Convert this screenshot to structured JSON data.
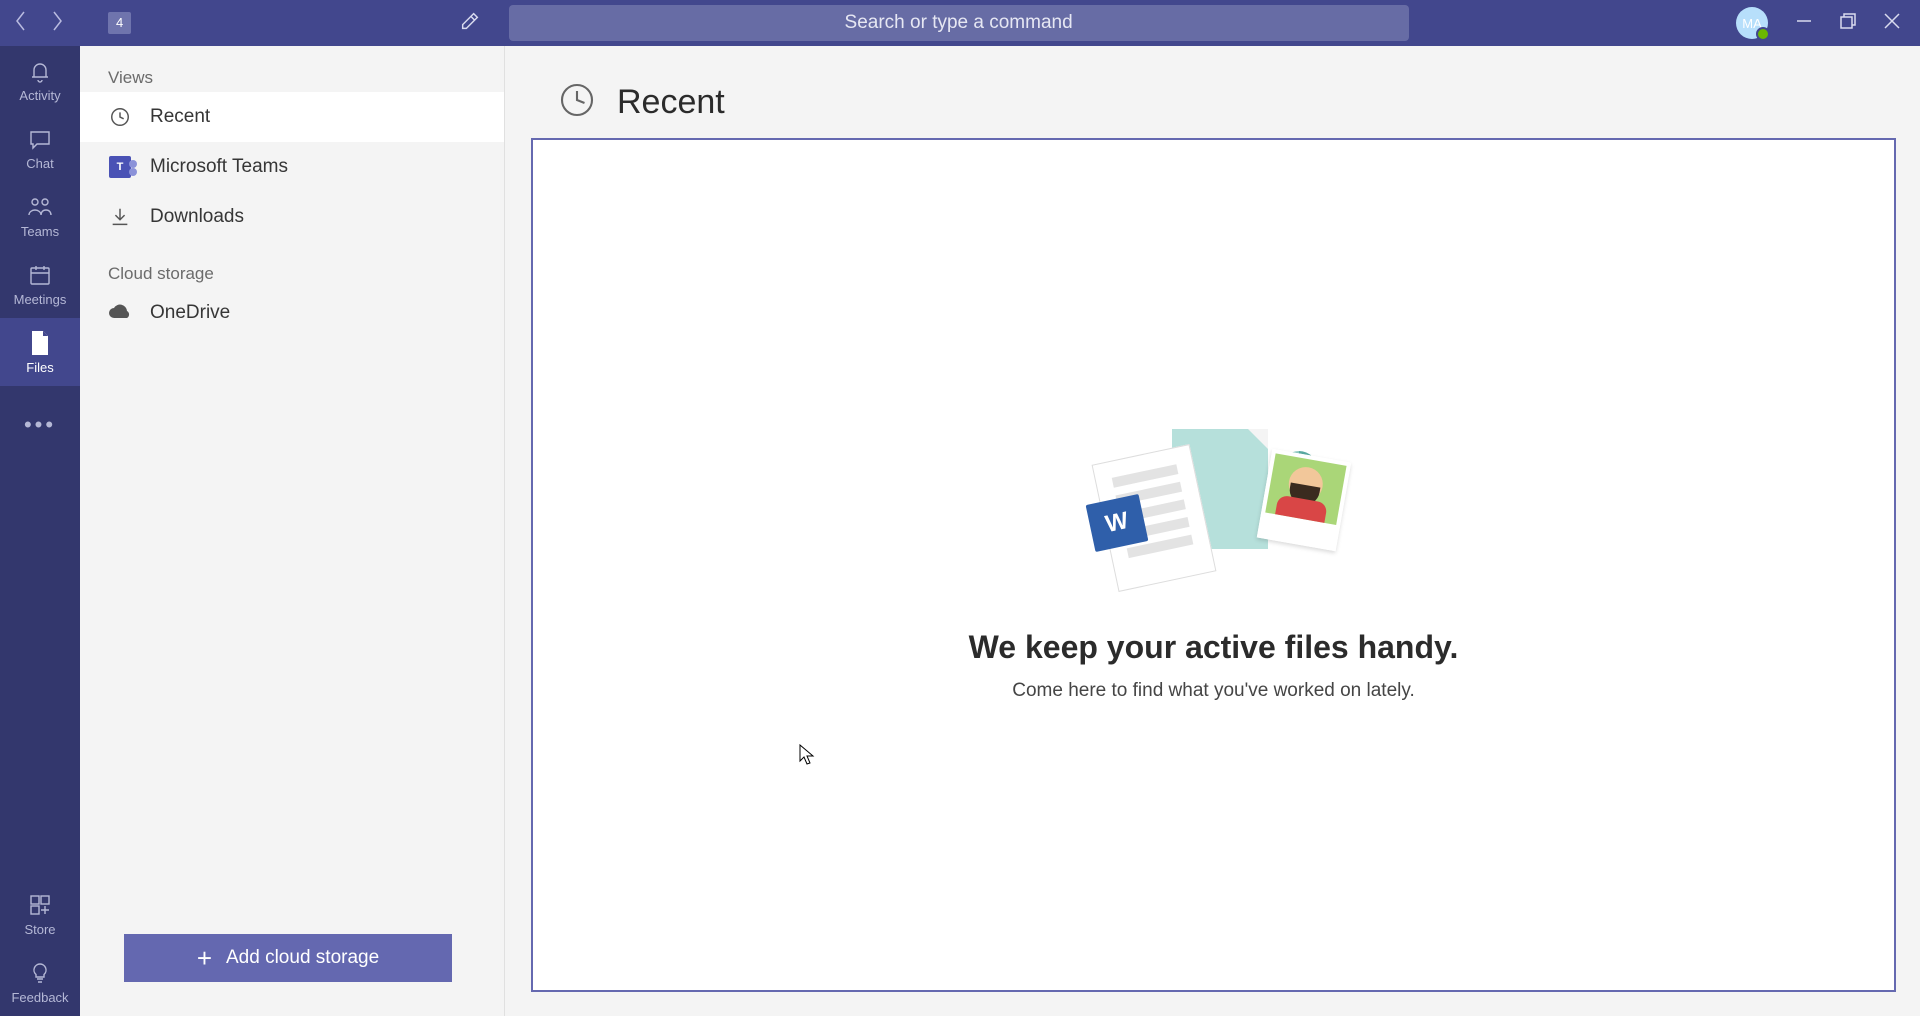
{
  "titlebar": {
    "notification_count": "4",
    "search_placeholder": "Search or type a command",
    "avatar_initials": "MA"
  },
  "rail": {
    "items": [
      {
        "label": "Activity"
      },
      {
        "label": "Chat"
      },
      {
        "label": "Teams"
      },
      {
        "label": "Meetings"
      },
      {
        "label": "Files"
      }
    ],
    "store": "Store",
    "feedback": "Feedback"
  },
  "sidebar": {
    "views_header": "Views",
    "views": [
      {
        "label": "Recent"
      },
      {
        "label": "Microsoft Teams"
      },
      {
        "label": "Downloads"
      }
    ],
    "cloud_header": "Cloud storage",
    "cloud_items": [
      {
        "label": "OneDrive"
      }
    ],
    "add_button": "Add cloud storage"
  },
  "content": {
    "title": "Recent",
    "empty_title": "We keep your active files handy.",
    "empty_subtitle": "Come here to find what you've worked on lately."
  }
}
